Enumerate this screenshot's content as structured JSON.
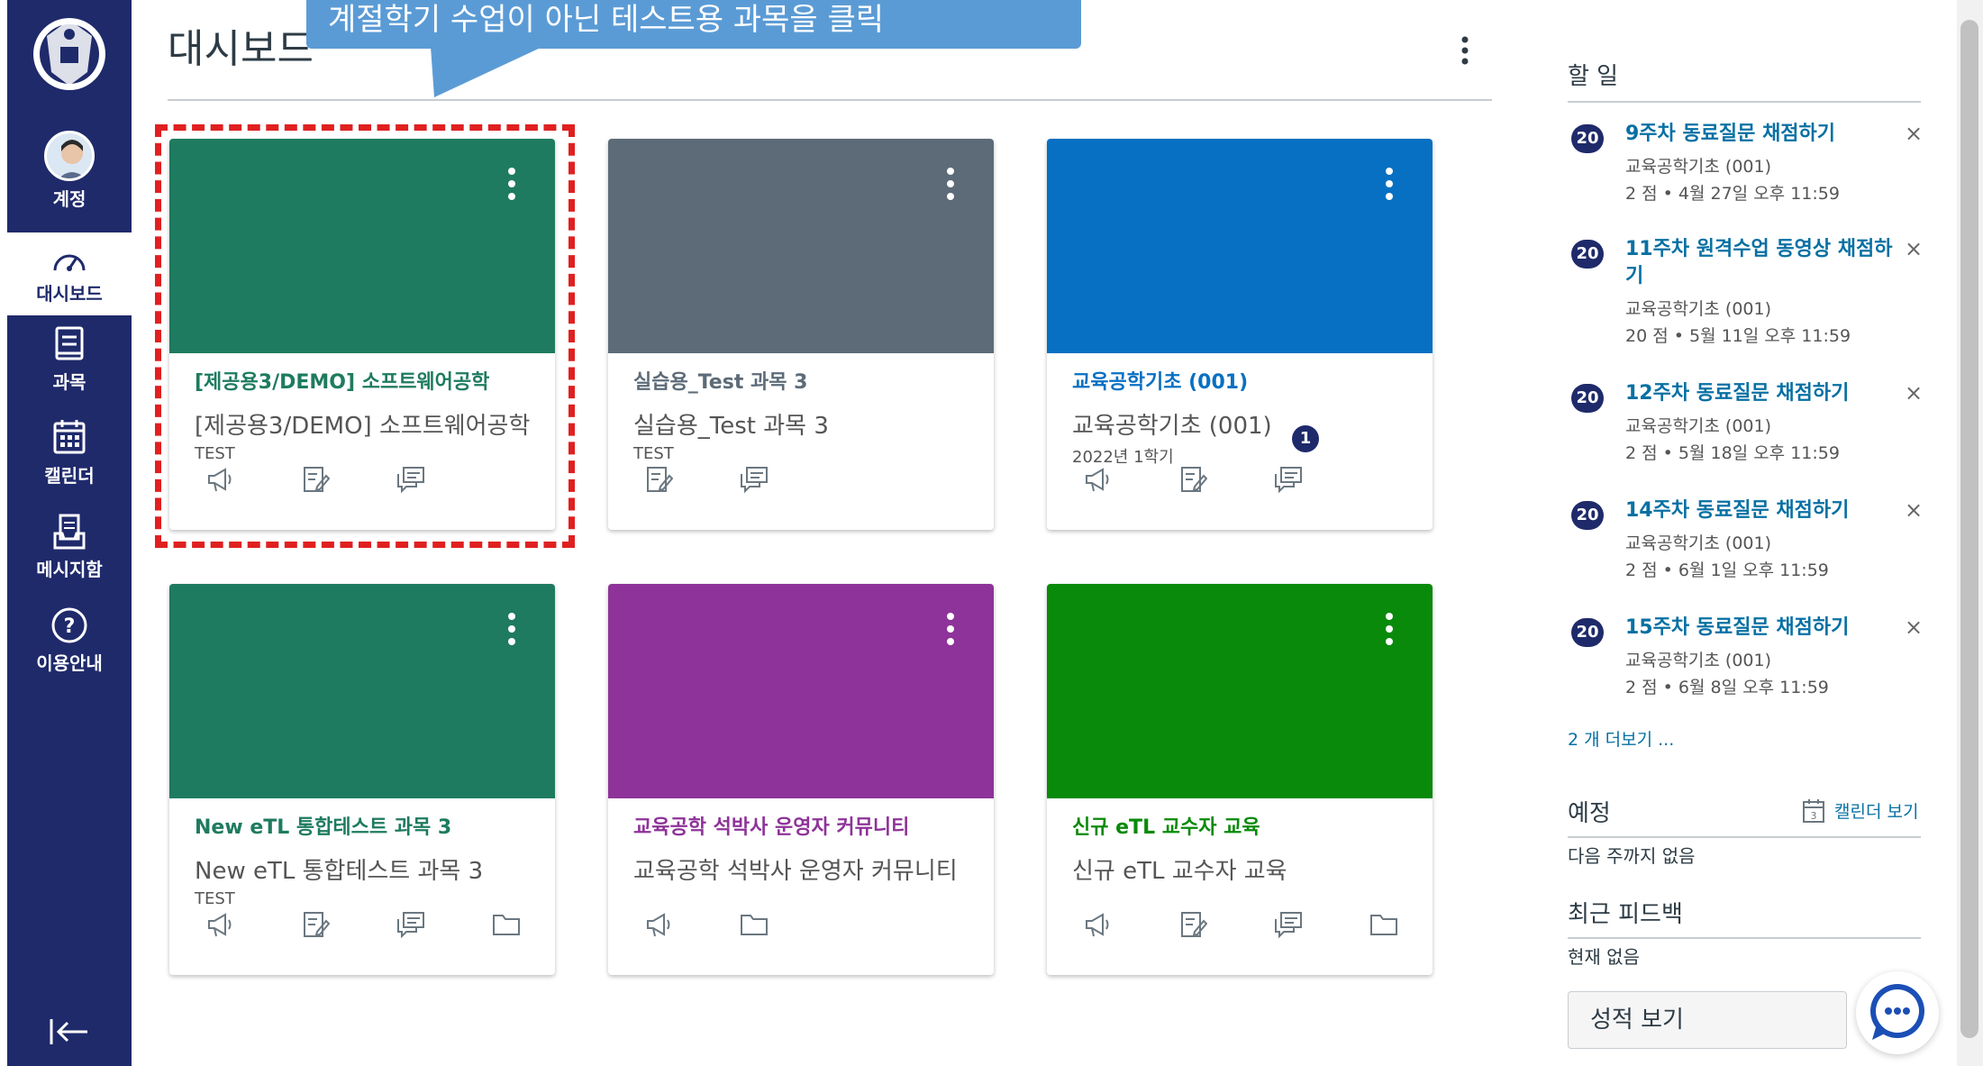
{
  "sidebar": {
    "items": [
      {
        "label": "계정"
      },
      {
        "label": "대시보드"
      },
      {
        "label": "과목"
      },
      {
        "label": "캘린더"
      },
      {
        "label": "메시지함"
      },
      {
        "label": "이용안내"
      }
    ],
    "active_item": "대시보드",
    "background_color": "#1f2a6b"
  },
  "header": {
    "title": "대시보드"
  },
  "callout": {
    "text": "계절학기 수업이 아닌 테스트용 과목을 클릭"
  },
  "cards": [
    {
      "title": "[제공용3/DEMO] 소프트웨어공학",
      "subtitle": "[제공용3/DEMO] 소프트웨어공학",
      "term": "TEST",
      "color": "#1e7b5f",
      "title_color": "#1e7b5f",
      "icons": [
        "megaphone-icon",
        "assignment-icon",
        "discussion-icon"
      ]
    },
    {
      "title": "실습용_Test 과목 3",
      "subtitle": "실습용_Test 과목 3",
      "term": "TEST",
      "color": "#5d6b78",
      "title_color": "#5d6b78",
      "icons": [
        "assignment-icon",
        "discussion-icon"
      ]
    },
    {
      "title": "교육공학기초 (001)",
      "subtitle": "교육공학기초 (001)",
      "term": "2022년 1학기",
      "color": "#0770c2",
      "title_color": "#0770c2",
      "icons": [
        "megaphone-icon",
        "assignment-icon",
        "discussion-icon"
      ],
      "badge": "1"
    },
    {
      "title": "New eTL 통합테스트 과목 3",
      "subtitle": "New eTL 통합테스트 과목 3",
      "term": "TEST",
      "color": "#1e7b5f",
      "title_color": "#1e7b5f",
      "icons": [
        "megaphone-icon",
        "assignment-icon",
        "discussion-icon",
        "folder-icon"
      ]
    },
    {
      "title": "교육공학 석박사 운영자 커뮤니티",
      "subtitle": "교육공학 석박사 운영자 커뮤니티",
      "term": "",
      "color": "#8e3399",
      "title_color": "#8e3399",
      "icons": [
        "megaphone-icon",
        "folder-icon"
      ]
    },
    {
      "title": "신규 eTL 교수자 교육",
      "subtitle": "신규 eTL 교수자 교육",
      "term": "",
      "color": "#0a8a0a",
      "title_color": "#0a8a0a",
      "icons": [
        "megaphone-icon",
        "assignment-icon",
        "discussion-icon",
        "folder-icon"
      ]
    }
  ],
  "todo": {
    "heading": "할 일",
    "items": [
      {
        "badge": "20",
        "title": "9주차 동료질문 채점하기",
        "course": "교육공학기초 (001)",
        "meta": "2 점 • 4월 27일 오후 11:59"
      },
      {
        "badge": "20",
        "title": "11주차 원격수업 동영상 채점하기",
        "course": "교육공학기초 (001)",
        "meta": "20 점 • 5월 11일 오후 11:59"
      },
      {
        "badge": "20",
        "title": "12주차 동료질문 채점하기",
        "course": "교육공학기초 (001)",
        "meta": "2 점 • 5월 18일 오후 11:59"
      },
      {
        "badge": "20",
        "title": "14주차 동료질문 채점하기",
        "course": "교육공학기초 (001)",
        "meta": "2 점 • 6월 1일 오후 11:59"
      },
      {
        "badge": "20",
        "title": "15주차 동료질문 채점하기",
        "course": "교육공학기초 (001)",
        "meta": "2 점 • 6월 8일 오후 11:59"
      }
    ],
    "more_link": "2 개 더보기 ..."
  },
  "upcoming": {
    "heading": "예정",
    "calendar_link": "캘린더 보기",
    "calendar_icon_number": "3",
    "empty_text": "다음 주까지 없음"
  },
  "feedback": {
    "heading": "최근 피드백",
    "empty_text": "현재 없음"
  },
  "grades_button": "성적 보기",
  "colors": {
    "link": "#0770a3",
    "highlight_box": "#e02020",
    "callout": "#5b9bd5"
  }
}
